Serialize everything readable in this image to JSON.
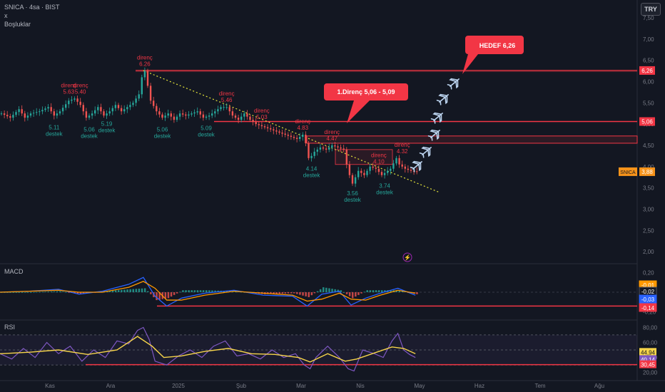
{
  "header": {
    "symbol_line": "SNICA · 4sa · BIST",
    "line2": "x",
    "line3": "Boşluklar",
    "currency": "TRY"
  },
  "colors": {
    "bg": "#131722",
    "red": "#f23645",
    "teal": "#26a69a",
    "candle_up": "#26a69a",
    "candle_down": "#ef5350",
    "yellow_dotted": "#e5e53a",
    "macd_line": "#2962ff",
    "signal_line": "#ff9800",
    "rsi_line": "#7e57c2",
    "rsi_ma": "#f7d54a",
    "price_tag": "#f7931a"
  },
  "chart_data": {
    "type": "line",
    "x_axis_labels": [
      "Kas",
      "Ara",
      "2025",
      "Şub",
      "Mar",
      "Nis",
      "May",
      "Haz",
      "Tem",
      "Ağu"
    ],
    "price_axis": {
      "ticks": [
        "7,50",
        "7,00",
        "6,50",
        "6,00",
        "5,50",
        "5,00",
        "4,50",
        "4,00",
        "3,50",
        "3,00",
        "2,50",
        "2,00"
      ],
      "ylim": [
        1.75,
        7.75
      ]
    },
    "price_series": [
      [
        0,
        5.25
      ],
      [
        3,
        5.15
      ],
      [
        6,
        5.35
      ],
      [
        8,
        5.15
      ],
      [
        10,
        5.25
      ],
      [
        13,
        5.3
      ],
      [
        16,
        5.4
      ],
      [
        18,
        5.2
      ],
      [
        20,
        5.3
      ],
      [
        23,
        5.55
      ],
      [
        25,
        5.6
      ],
      [
        27,
        5.45
      ],
      [
        29,
        5.15
      ],
      [
        31,
        5.25
      ],
      [
        33,
        5.4
      ],
      [
        35,
        5.2
      ],
      [
        37,
        5.3
      ],
      [
        39,
        5.45
      ],
      [
        41,
        5.3
      ],
      [
        43,
        5.4
      ],
      [
        45,
        5.5
      ],
      [
        47,
        5.7
      ],
      [
        48,
        6.1
      ],
      [
        49,
        6.25
      ],
      [
        50,
        5.9
      ],
      [
        51,
        5.55
      ],
      [
        53,
        5.3
      ],
      [
        55,
        5.15
      ],
      [
        57,
        5.25
      ],
      [
        59,
        5.1
      ],
      [
        61,
        5.25
      ],
      [
        63,
        5.2
      ],
      [
        65,
        5.25
      ],
      [
        67,
        5.3
      ],
      [
        69,
        5.15
      ],
      [
        71,
        5.2
      ],
      [
        73,
        5.3
      ],
      [
        75,
        5.4
      ],
      [
        77,
        5.4
      ],
      [
        79,
        5.2
      ],
      [
        81,
        5.1
      ],
      [
        83,
        5.25
      ],
      [
        85,
        5.1
      ],
      [
        87,
        5.0
      ],
      [
        89,
        4.95
      ],
      [
        91,
        4.9
      ],
      [
        93,
        4.85
      ],
      [
        95,
        4.8
      ],
      [
        97,
        4.75
      ],
      [
        99,
        4.7
      ],
      [
        101,
        4.65
      ],
      [
        103,
        4.75
      ],
      [
        104,
        4.55
      ],
      [
        105,
        4.2
      ],
      [
        106,
        4.25
      ],
      [
        107,
        4.35
      ],
      [
        109,
        4.45
      ],
      [
        111,
        4.4
      ],
      [
        113,
        4.5
      ],
      [
        115,
        4.45
      ],
      [
        117,
        4.4
      ],
      [
        118,
        4.05
      ],
      [
        119,
        3.8
      ],
      [
        120,
        3.6
      ],
      [
        121,
        3.75
      ],
      [
        122,
        3.9
      ],
      [
        124,
        3.8
      ],
      [
        126,
        4.0
      ],
      [
        128,
        3.95
      ],
      [
        130,
        3.8
      ],
      [
        131,
        3.85
      ],
      [
        133,
        3.95
      ],
      [
        135,
        4.2
      ],
      [
        136,
        4.05
      ],
      [
        138,
        3.95
      ],
      [
        140,
        3.9
      ],
      [
        142,
        3.88
      ]
    ],
    "series_labels": [
      {
        "text": "direnç",
        "value": "5.63",
        "x": 23
      },
      {
        "text": "direnç",
        "value": "5.40",
        "x": 27
      },
      {
        "text": "direnç",
        "value": "6.26",
        "x": 49
      },
      {
        "text": "direnç",
        "value": "5.46",
        "x": 77
      },
      {
        "text": "direnç",
        "value": "5.03",
        "x": 89
      },
      {
        "text": "direnç",
        "value": "4.83",
        "x": 103
      },
      {
        "text": "direnç",
        "value": "4.47",
        "x": 113
      },
      {
        "text": "direnç",
        "value": "4.10",
        "x": 129
      },
      {
        "text": "direnç",
        "value": "4.32",
        "x": 137
      }
    ],
    "support_labels": [
      {
        "value": "5.11",
        "text": "destek",
        "x": 18
      },
      {
        "value": "5.06",
        "text": "destek",
        "x": 30
      },
      {
        "value": "5.19",
        "text": "destek",
        "x": 36
      },
      {
        "value": "5.06",
        "text": "destek",
        "x": 55
      },
      {
        "value": "5.09",
        "text": "destek",
        "x": 70
      },
      {
        "value": "4.14",
        "text": "destek",
        "x": 106
      },
      {
        "value": "3.56",
        "text": "destek",
        "x": 120
      },
      {
        "value": "3.74",
        "text": "destek",
        "x": 131
      }
    ],
    "horizontal_levels": [
      6.26,
      5.06
    ],
    "resistance_zone": [
      4.55,
      4.72
    ],
    "trendline": {
      "from": [
        49,
        6.26
      ],
      "to": [
        152,
        3.4
      ]
    },
    "annotations": [
      {
        "text": "HEDEF 6,26"
      },
      {
        "text": "1.Direnç 5,06 - 5,09"
      }
    ],
    "price_tags": [
      {
        "label": "6,26",
        "value": 6.26,
        "color": "#f23645"
      },
      {
        "label": "5,06",
        "value": 5.06,
        "color": "#f23645"
      },
      {
        "label": "SNICA",
        "value": 3.88,
        "color": "#f7931a",
        "symbol": true
      },
      {
        "label": "3,88",
        "value": 3.88,
        "color": "#f7931a"
      }
    ],
    "macd": {
      "title": "MACD",
      "ticks": [
        "0,20",
        "0,00",
        "-0,20"
      ],
      "ylim": [
        -0.26,
        0.26
      ],
      "tags": [
        {
          "label": "-0,01",
          "color": "#ff9800"
        },
        {
          "label": "-0,02",
          "color": "#131722"
        },
        {
          "label": "-0,03",
          "color": "#2962ff"
        },
        {
          "label": "-0,14",
          "color": "#f23645"
        }
      ],
      "macd_line": [
        [
          0,
          0.0
        ],
        [
          10,
          0.01
        ],
        [
          20,
          0.03
        ],
        [
          27,
          -0.02
        ],
        [
          35,
          0.01
        ],
        [
          44,
          0.08
        ],
        [
          49,
          0.15
        ],
        [
          53,
          -0.04
        ],
        [
          57,
          -0.14
        ],
        [
          62,
          -0.06
        ],
        [
          70,
          -0.01
        ],
        [
          80,
          0.02
        ],
        [
          90,
          -0.03
        ],
        [
          100,
          -0.04
        ],
        [
          105,
          -0.14
        ],
        [
          110,
          -0.02
        ],
        [
          116,
          0.01
        ],
        [
          120,
          -0.13
        ],
        [
          125,
          -0.06
        ],
        [
          130,
          -0.01
        ],
        [
          136,
          0.04
        ],
        [
          142,
          -0.03
        ]
      ],
      "signal_line": [
        [
          0,
          0.0
        ],
        [
          10,
          0.01
        ],
        [
          20,
          0.02
        ],
        [
          27,
          0.0
        ],
        [
          35,
          0.0
        ],
        [
          44,
          0.05
        ],
        [
          49,
          0.11
        ],
        [
          53,
          0.04
        ],
        [
          57,
          -0.08
        ],
        [
          62,
          -0.08
        ],
        [
          70,
          -0.03
        ],
        [
          80,
          0.01
        ],
        [
          90,
          -0.01
        ],
        [
          100,
          -0.03
        ],
        [
          105,
          -0.09
        ],
        [
          110,
          -0.07
        ],
        [
          116,
          -0.01
        ],
        [
          120,
          -0.07
        ],
        [
          125,
          -0.08
        ],
        [
          130,
          -0.03
        ],
        [
          136,
          0.02
        ],
        [
          142,
          -0.01
        ]
      ],
      "level": -0.14
    },
    "rsi": {
      "title": "RSI",
      "ticks": [
        "80,00",
        "60,00",
        "40,00",
        "20,00"
      ],
      "ylim": [
        13,
        87
      ],
      "tags": [
        {
          "label": "44,94",
          "color": "#f7d54a"
        },
        {
          "label": "40,14",
          "color": "#7e57c2"
        },
        {
          "label": "30,45",
          "color": "#f23645"
        }
      ],
      "rsi_line": [
        [
          0,
          45
        ],
        [
          4,
          38
        ],
        [
          8,
          52
        ],
        [
          12,
          40
        ],
        [
          16,
          60
        ],
        [
          20,
          45
        ],
        [
          24,
          55
        ],
        [
          28,
          35
        ],
        [
          32,
          50
        ],
        [
          36,
          40
        ],
        [
          40,
          62
        ],
        [
          44,
          58
        ],
        [
          47,
          76
        ],
        [
          49,
          80
        ],
        [
          51,
          64
        ],
        [
          53,
          35
        ],
        [
          57,
          30
        ],
        [
          61,
          42
        ],
        [
          65,
          50
        ],
        [
          69,
          40
        ],
        [
          73,
          55
        ],
        [
          77,
          62
        ],
        [
          81,
          42
        ],
        [
          85,
          45
        ],
        [
          89,
          38
        ],
        [
          93,
          50
        ],
        [
          97,
          40
        ],
        [
          101,
          45
        ],
        [
          104,
          30
        ],
        [
          106,
          25
        ],
        [
          108,
          40
        ],
        [
          112,
          55
        ],
        [
          116,
          40
        ],
        [
          119,
          25
        ],
        [
          121,
          22
        ],
        [
          124,
          50
        ],
        [
          128,
          45
        ],
        [
          131,
          40
        ],
        [
          134,
          62
        ],
        [
          136,
          72
        ],
        [
          138,
          50
        ],
        [
          140,
          44
        ],
        [
          142,
          40
        ]
      ],
      "rsi_ma": [
        [
          0,
          45
        ],
        [
          10,
          47
        ],
        [
          20,
          50
        ],
        [
          30,
          44
        ],
        [
          40,
          50
        ],
        [
          47,
          68
        ],
        [
          52,
          55
        ],
        [
          56,
          40
        ],
        [
          62,
          42
        ],
        [
          70,
          48
        ],
        [
          78,
          52
        ],
        [
          86,
          45
        ],
        [
          94,
          44
        ],
        [
          102,
          40
        ],
        [
          106,
          34
        ],
        [
          112,
          45
        ],
        [
          118,
          35
        ],
        [
          122,
          38
        ],
        [
          128,
          46
        ],
        [
          134,
          54
        ],
        [
          138,
          52
        ],
        [
          142,
          45
        ]
      ],
      "level": 30.45
    }
  }
}
